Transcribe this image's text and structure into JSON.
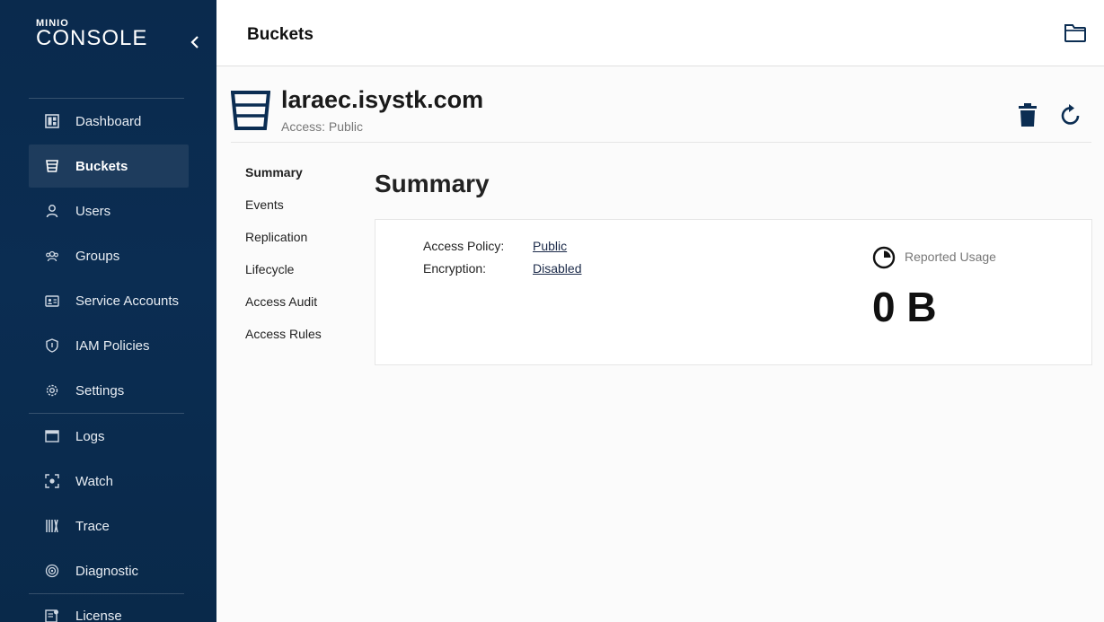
{
  "brand": {
    "small": "MINIO",
    "big": "CONSOLE"
  },
  "sidebar": {
    "items": [
      {
        "label": "Dashboard",
        "icon": "dashboard-icon"
      },
      {
        "label": "Buckets",
        "icon": "bucket-icon",
        "active": true
      },
      {
        "label": "Users",
        "icon": "user-icon"
      },
      {
        "label": "Groups",
        "icon": "groups-icon"
      },
      {
        "label": "Service Accounts",
        "icon": "service-accounts-icon"
      },
      {
        "label": "IAM Policies",
        "icon": "shield-icon"
      },
      {
        "label": "Settings",
        "icon": "gear-icon"
      },
      {
        "label": "Logs",
        "icon": "logs-icon"
      },
      {
        "label": "Watch",
        "icon": "watch-icon"
      },
      {
        "label": "Trace",
        "icon": "trace-icon"
      },
      {
        "label": "Diagnostic",
        "icon": "diagnostic-icon"
      },
      {
        "label": "License",
        "icon": "license-icon"
      }
    ]
  },
  "header": {
    "title": "Buckets"
  },
  "bucket": {
    "name": "laraec.isystk.com",
    "access": "Access: Public"
  },
  "subnav": {
    "items": [
      "Summary",
      "Events",
      "Replication",
      "Lifecycle",
      "Access Audit",
      "Access Rules"
    ],
    "active": "Summary"
  },
  "summary": {
    "title": "Summary",
    "access_policy_label": "Access Policy:",
    "access_policy_value": "Public",
    "encryption_label": "Encryption:",
    "encryption_value": "Disabled",
    "usage_label": "Reported Usage",
    "usage_value": "0 B"
  },
  "colors": {
    "sidebar_bg": "#0a2a4d",
    "accent": "#1b2a49"
  }
}
